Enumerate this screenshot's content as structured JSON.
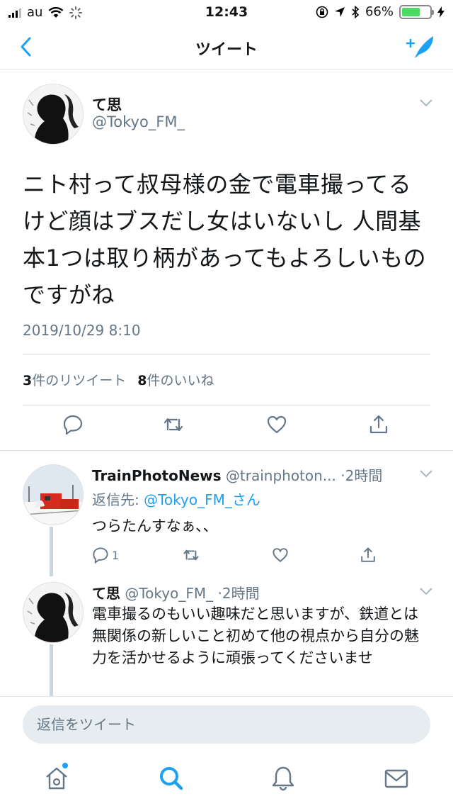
{
  "status_bar": {
    "carrier": "au",
    "time": "12:43",
    "battery_percent": "66%",
    "battery_level": 0.66
  },
  "nav": {
    "title": "ツイート"
  },
  "main_tweet": {
    "name": "て思",
    "handle": "@Tokyo_FM_",
    "text": "ニト村って叔母様の金で電車撮ってるけど顔はブスだし女はいないし 人間基本1つは取り柄があってもよろしいものですがね",
    "date": "2019/10/29 8:10",
    "retweet_count": "3",
    "retweet_label": "件のリツイート",
    "like_count": "8",
    "like_label": "件のいいね"
  },
  "replies": [
    {
      "name": "TrainPhotoNews",
      "handle": "@trainphoton...",
      "time": "·2時間",
      "reply_to_prefix": "返信先: ",
      "reply_to_link": "@Tokyo_FM_さん",
      "text": "つらたんすなぁ、、",
      "reply_count": "1"
    },
    {
      "name": "て思",
      "handle": "@Tokyo_FM_",
      "time": "·2時間",
      "text": "電車撮るのもいい趣味だと思いますが、鉄道とは無関係の新しいこと初めて他の視点から自分の魅力を活かせるように頑張ってくださいませ"
    }
  ],
  "reply_bar": {
    "placeholder": "返信をツイート"
  },
  "colors": {
    "accent": "#1da1f2",
    "text": "#14171a",
    "secondary": "#657786",
    "border": "#e1e8ed",
    "battery": "#4cd964"
  },
  "icons": {
    "nav": [
      "back-chevron-icon",
      "compose-tweet-icon"
    ],
    "actions": [
      "reply-icon",
      "retweet-icon",
      "like-icon",
      "share-icon"
    ],
    "tabs": [
      "home-icon",
      "search-icon",
      "notifications-icon",
      "messages-icon"
    ]
  }
}
